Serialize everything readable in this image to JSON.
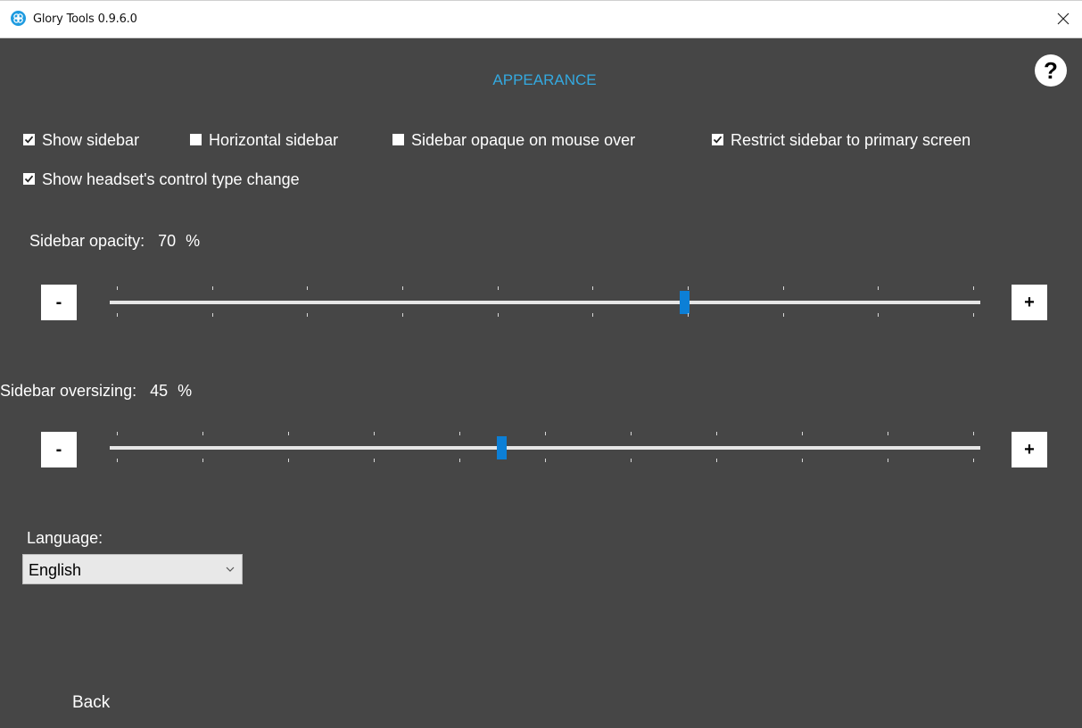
{
  "window": {
    "title": "Glory Tools 0.9.6.0"
  },
  "page": {
    "heading": "APPEARANCE",
    "help_label": "?"
  },
  "checkboxes": [
    {
      "label": "Show sidebar",
      "checked": true
    },
    {
      "label": "Horizontal sidebar",
      "checked": false
    },
    {
      "label": "Sidebar opaque on mouse over",
      "checked": false
    },
    {
      "label": "Restrict sidebar to primary screen",
      "checked": true
    },
    {
      "label": "Show headset's control type change",
      "checked": true
    }
  ],
  "opacity": {
    "label": "Sidebar opacity:",
    "value": "70",
    "unit": "%",
    "minus": "-",
    "plus": "+",
    "fraction": 0.662
  },
  "oversizing": {
    "label": "Sidebar oversizing:",
    "value": "45",
    "unit": "%",
    "minus": "-",
    "plus": "+",
    "fraction": 0.45
  },
  "language": {
    "label": "Language:",
    "selected": "English"
  },
  "nav": {
    "back": "Back"
  },
  "colors": {
    "background": "#464646",
    "accent": "#34a9e0",
    "thumb": "#0c7fd6"
  }
}
